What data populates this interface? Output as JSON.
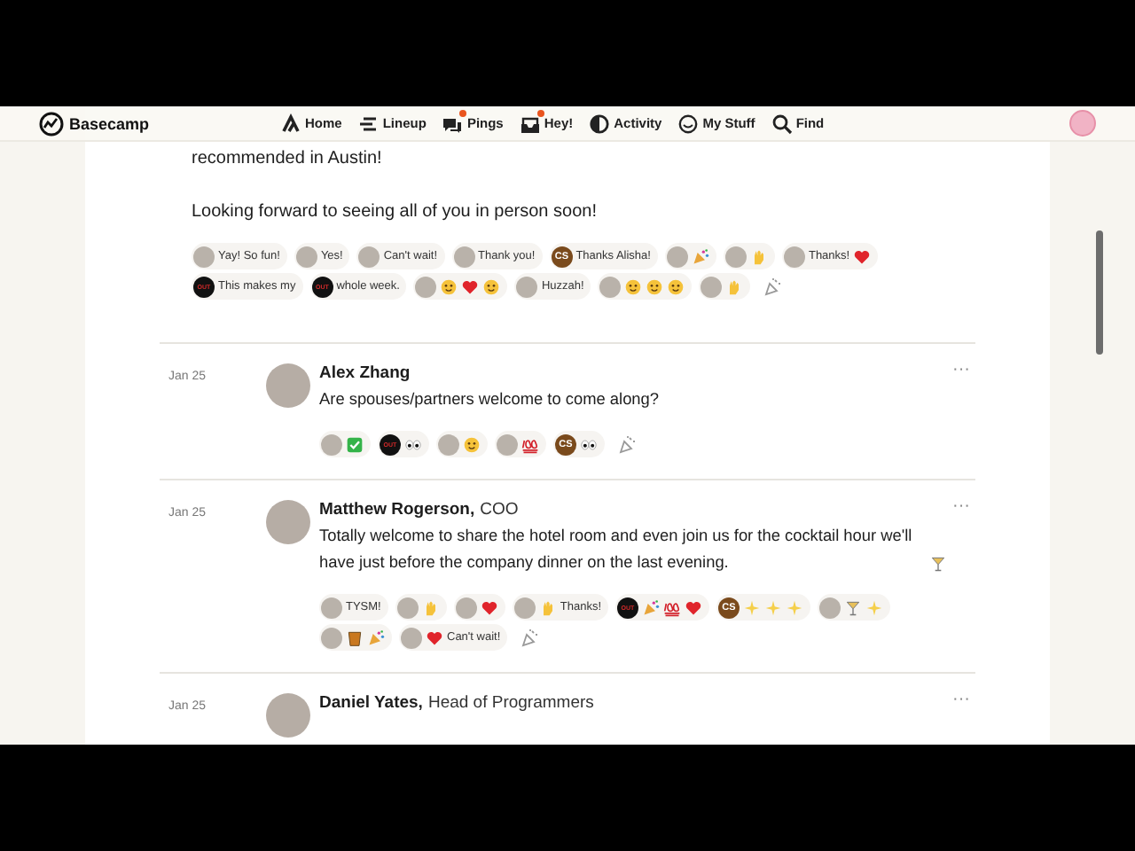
{
  "nav": {
    "logo": "Basecamp",
    "items": [
      {
        "label": "Home",
        "badge": false
      },
      {
        "label": "Lineup",
        "badge": false
      },
      {
        "label": "Pings",
        "badge": true
      },
      {
        "label": "Hey!",
        "badge": true
      },
      {
        "label": "Activity",
        "badge": false
      },
      {
        "label": "My Stuff",
        "badge": false
      },
      {
        "label": "Find",
        "badge": false
      }
    ]
  },
  "intro": {
    "paragraphs": [
      "recommended in Austin!",
      "Looking forward to seeing all of you in person soon!"
    ],
    "reactions": [
      {
        "avatar": {
          "kind": "photo"
        },
        "parts": [
          {
            "kind": "text",
            "text": "Yay! So fun!"
          }
        ]
      },
      {
        "avatar": {
          "kind": "photo"
        },
        "parts": [
          {
            "kind": "text",
            "text": "Yes!"
          }
        ]
      },
      {
        "avatar": {
          "kind": "photo"
        },
        "parts": [
          {
            "kind": "text",
            "text": "Can't wait!"
          }
        ]
      },
      {
        "avatar": {
          "kind": "photo"
        },
        "parts": [
          {
            "kind": "text",
            "text": "Thank you!"
          }
        ]
      },
      {
        "avatar": {
          "kind": "initials",
          "text": "CS"
        },
        "parts": [
          {
            "kind": "text",
            "text": "Thanks Alisha!"
          }
        ]
      },
      {
        "avatar": {
          "kind": "photo"
        },
        "parts": [
          {
            "kind": "party"
          }
        ]
      },
      {
        "avatar": {
          "kind": "photo"
        },
        "parts": [
          {
            "kind": "hand"
          }
        ]
      },
      {
        "avatar": {
          "kind": "photo"
        },
        "parts": [
          {
            "kind": "text",
            "text": "Thanks!"
          },
          {
            "kind": "heart"
          }
        ]
      },
      {
        "avatar": {
          "kind": "badge",
          "text": "OUT"
        },
        "parts": [
          {
            "kind": "text",
            "text": "This makes my"
          }
        ]
      },
      {
        "avatar": {
          "kind": "badge",
          "text": "OUT"
        },
        "parts": [
          {
            "kind": "text",
            "text": "whole week."
          }
        ]
      },
      {
        "avatar": {
          "kind": "photo"
        },
        "parts": [
          {
            "kind": "face"
          },
          {
            "kind": "heart"
          },
          {
            "kind": "face"
          }
        ]
      },
      {
        "avatar": {
          "kind": "photo"
        },
        "parts": [
          {
            "kind": "text",
            "text": "Huzzah!"
          }
        ]
      },
      {
        "avatar": {
          "kind": "photo"
        },
        "parts": [
          {
            "kind": "face"
          },
          {
            "kind": "face"
          },
          {
            "kind": "face"
          }
        ]
      },
      {
        "avatar": {
          "kind": "photo"
        },
        "parts": [
          {
            "kind": "hand"
          }
        ]
      }
    ]
  },
  "messages": [
    {
      "date": "Jan 25",
      "author": "Alex Zhang",
      "parts": [
        {
          "kind": "text",
          "text": "Are spouses/partners welcome to come along?"
        }
      ],
      "menu": "···",
      "reactions": [
        {
          "avatar": {
            "kind": "photo"
          },
          "parts": [
            {
              "kind": "check"
            }
          ]
        },
        {
          "avatar": {
            "kind": "badge",
            "text": "OUT"
          },
          "parts": [
            {
              "kind": "eyes"
            }
          ]
        },
        {
          "avatar": {
            "kind": "photo"
          },
          "parts": [
            {
              "kind": "face"
            }
          ]
        },
        {
          "avatar": {
            "kind": "photo"
          },
          "parts": [
            {
              "kind": "hundred"
            }
          ]
        },
        {
          "avatar": {
            "kind": "initials",
            "text": "CS"
          },
          "parts": [
            {
              "kind": "eyes"
            }
          ]
        }
      ]
    },
    {
      "date": "Jan 25",
      "author": "Matthew Rogerson,",
      "role": "COO",
      "parts": [
        {
          "kind": "text",
          "text": "Totally welcome to share the hotel room and even join us for the cocktail hour we'll have just before the company dinner on the last evening."
        },
        {
          "kind": "cocktail"
        }
      ],
      "menu": "···",
      "reactions": [
        {
          "avatar": {
            "kind": "photo"
          },
          "parts": [
            {
              "kind": "text",
              "text": "TYSM!"
            }
          ]
        },
        {
          "avatar": {
            "kind": "photo"
          },
          "parts": [
            {
              "kind": "hand"
            }
          ]
        },
        {
          "avatar": {
            "kind": "photo"
          },
          "parts": [
            {
              "kind": "heart"
            }
          ]
        },
        {
          "avatar": {
            "kind": "photo"
          },
          "parts": [
            {
              "kind": "hand"
            },
            {
              "kind": "text",
              "text": "Thanks!"
            }
          ]
        },
        {
          "avatar": {
            "kind": "badge",
            "text": "OUT"
          },
          "parts": [
            {
              "kind": "party"
            },
            {
              "kind": "hundred"
            },
            {
              "kind": "heart"
            }
          ]
        },
        {
          "avatar": {
            "kind": "initials",
            "text": "CS"
          },
          "parts": [
            {
              "kind": "sparkle"
            },
            {
              "kind": "sparkle"
            },
            {
              "kind": "sparkle"
            }
          ]
        },
        {
          "avatar": {
            "kind": "photo"
          },
          "parts": [
            {
              "kind": "cocktail"
            },
            {
              "kind": "sparkle"
            }
          ]
        },
        {
          "avatar": {
            "kind": "photo"
          },
          "parts": [
            {
              "kind": "glass"
            },
            {
              "kind": "party"
            }
          ]
        },
        {
          "avatar": {
            "kind": "photo"
          },
          "parts": [
            {
              "kind": "heart"
            },
            {
              "kind": "text",
              "text": "Can't wait!"
            }
          ]
        }
      ]
    },
    {
      "date": "Jan 25",
      "author": "Daniel Yates,",
      "role": "Head of Programmers",
      "menu": "···"
    }
  ]
}
